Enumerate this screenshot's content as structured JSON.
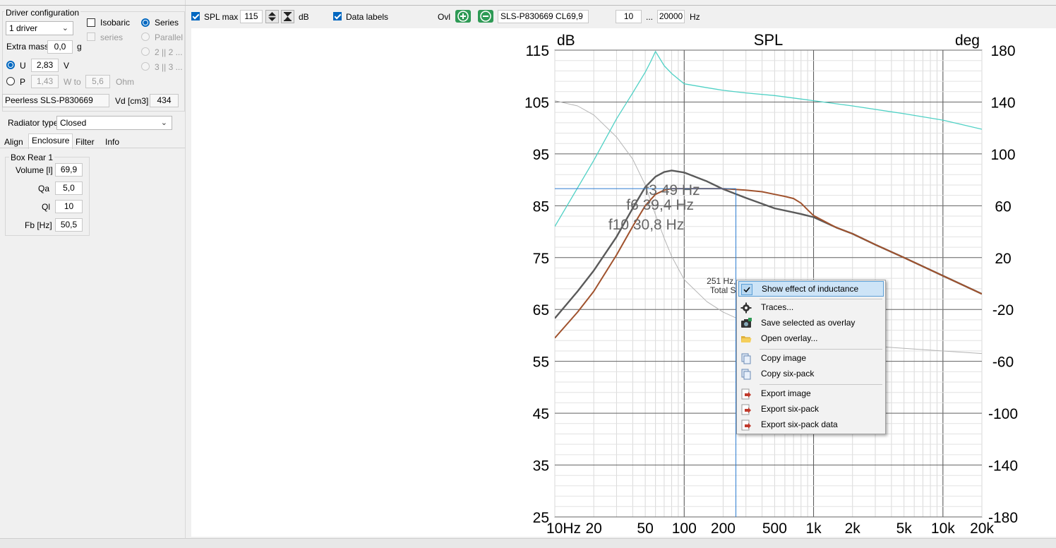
{
  "left_panel": {
    "driver_config_title": "Driver configuration",
    "driver_count": "1 driver",
    "isobaric_label": "Isobaric",
    "series_sub_label": "series",
    "series_label": "Series",
    "parallel_label": "Parallel",
    "opt_2x2": "2 || 2 ...",
    "opt_3x3": "3 || 3 ...",
    "extra_mass_label": "Extra mass",
    "extra_mass_value": "0,0",
    "extra_mass_unit": "g",
    "u_label": "U",
    "u_value": "2,83",
    "u_unit": "V",
    "p_label": "P",
    "p_value": "1,43",
    "w_to_label": "W to",
    "ohm_value": "5,6",
    "ohm_unit": "Ohm",
    "driver_name": "Peerless SLS-P830669",
    "vd_label": "Vd [cm3]",
    "vd_value": "434",
    "radiator_label": "Radiator type",
    "radiator_value": "Closed",
    "tabs": [
      "Align",
      "Enclosure",
      "Filter",
      "Info"
    ],
    "box_title": "Box Rear 1",
    "box_fields": [
      {
        "label": "Volume [l]",
        "value": "69,9"
      },
      {
        "label": "Qa",
        "value": "5,0"
      },
      {
        "label": "Ql",
        "value": "10"
      },
      {
        "label": "Fb [Hz]",
        "value": "50,5"
      }
    ]
  },
  "toolbar": {
    "spl_max_label": "SPL max",
    "spl_max_value": "115",
    "db_unit": "dB",
    "data_labels_label": "Data labels",
    "ovl_label": "Ovl",
    "overlay_name": "SLS-P830669 CL69,9",
    "freq_min": "10",
    "freq_sep": "...",
    "freq_max": "20000",
    "hz_unit": "Hz"
  },
  "context_menu": {
    "items": [
      {
        "label": "Show effect of inductance",
        "checked": true
      },
      {
        "label": "Traces..."
      },
      {
        "label": "Save selected as overlay"
      },
      {
        "label": "Open overlay..."
      },
      {
        "label": "Copy image"
      },
      {
        "label": "Copy six-pack"
      },
      {
        "label": "Export image"
      },
      {
        "label": "Export six-pack"
      },
      {
        "label": "Export six-pack data"
      }
    ]
  },
  "chart_data": {
    "type": "line",
    "title": "SPL",
    "y_left_label": "dB",
    "y_right_label": "deg",
    "x_scale": "log",
    "xlim": [
      10,
      20000
    ],
    "ylim_left": [
      25,
      115
    ],
    "ylim_right": [
      -180,
      180
    ],
    "y_left_ticks": [
      25,
      35,
      45,
      55,
      65,
      75,
      85,
      95,
      105,
      115
    ],
    "y_right_ticks": [
      -180,
      -140,
      -100,
      -60,
      -20,
      20,
      60,
      100,
      140,
      180
    ],
    "x_ticks": [
      {
        "value": 10,
        "label": "10Hz"
      },
      {
        "value": 20,
        "label": "20"
      },
      {
        "value": 50,
        "label": "50"
      },
      {
        "value": 100,
        "label": "100"
      },
      {
        "value": 200,
        "label": "200"
      },
      {
        "value": 500,
        "label": "500"
      },
      {
        "value": 1000,
        "label": "1k"
      },
      {
        "value": 2000,
        "label": "2k"
      },
      {
        "value": 5000,
        "label": "5k"
      },
      {
        "value": 10000,
        "label": "10k"
      },
      {
        "value": 20000,
        "label": "20k"
      }
    ],
    "grid": true,
    "colors": {
      "spl_dark": "#5a5a5a",
      "spl_brown": "#a0522d",
      "phase": "#4fd1c5",
      "gray_trace": "#b4b4b4",
      "marker": "#2b7bd0"
    },
    "series": [
      {
        "key": "spl_dark",
        "x": [
          10,
          15,
          20,
          30,
          40,
          50,
          60,
          70,
          80,
          100,
          150,
          200,
          300,
          500,
          800,
          1000,
          1500,
          2000,
          3000,
          5000,
          10000,
          20000
        ],
        "y": [
          63.3,
          68.5,
          72.5,
          79,
          84.5,
          88.6,
          90.6,
          91.5,
          91.8,
          91.4,
          89.7,
          88.2,
          86.5,
          84.5,
          83.4,
          82.8,
          80.8,
          79.6,
          77.5,
          75,
          71.5,
          68
        ]
      },
      {
        "key": "spl_brown",
        "x": [
          10,
          15,
          20,
          30,
          40,
          50,
          60,
          70,
          80,
          100,
          150,
          200,
          300,
          400,
          500,
          600,
          700,
          800,
          900,
          1000,
          1500,
          2000,
          3000,
          5000,
          10000,
          20000
        ],
        "y": [
          59.5,
          64.5,
          68.5,
          75.5,
          81,
          85,
          87.2,
          88,
          88.3,
          88.3,
          88.3,
          88.3,
          88,
          87.7,
          87.2,
          86.8,
          86.4,
          85.5,
          84.2,
          83.1,
          80.8,
          79.6,
          77.5,
          75,
          71.5,
          68
        ]
      },
      {
        "key": "phase",
        "axis": "right",
        "x": [
          10,
          20,
          30,
          40,
          50,
          55,
          60,
          70,
          80,
          100,
          150,
          200,
          300,
          500,
          1000,
          2000,
          5000,
          10000,
          20000
        ],
        "y": [
          44,
          95,
          127,
          147,
          163,
          171,
          179,
          168,
          162,
          154,
          151,
          149,
          147,
          145,
          141,
          137,
          131,
          126,
          119
        ]
      },
      {
        "key": "gray_trace",
        "axis": "right",
        "x": [
          10,
          15,
          20,
          30,
          40,
          50,
          60,
          70,
          80,
          100,
          150,
          200,
          300,
          500,
          1000,
          2000,
          5000,
          10000,
          20000
        ],
        "y": [
          141,
          137,
          130,
          113,
          96,
          76,
          53,
          35,
          21,
          3,
          -14,
          -22,
          -30,
          -37,
          -43,
          -47,
          -50,
          -52,
          -54
        ]
      }
    ],
    "markers": [
      {
        "type": "hline",
        "y": 88.3,
        "x_from": 10,
        "x_to": 251
      },
      {
        "type": "vline",
        "x": 251,
        "y_from": 25,
        "y_to": 88.3
      }
    ],
    "annotations": [
      {
        "text": "f3 49 Hz",
        "x": 49,
        "y": 88.2
      },
      {
        "text": "f6 39,4 Hz",
        "x": 39.4,
        "y": 85.3
      },
      {
        "text": "f10 30,8 Hz",
        "x": 30.8,
        "y": 81.5
      },
      {
        "text": "251 Hz,",
        "x": 251,
        "y": 70.5,
        "partial": true
      },
      {
        "text": "Total S",
        "x": 251,
        "y": 68.7,
        "partial": true
      }
    ]
  }
}
